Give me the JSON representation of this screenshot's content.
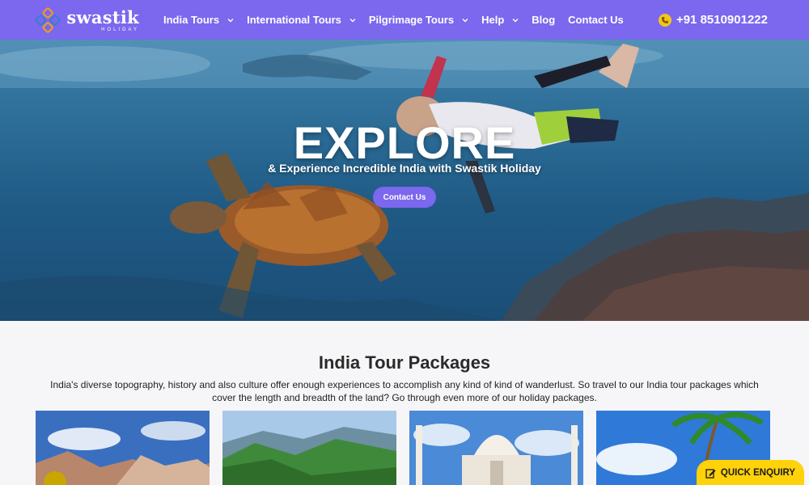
{
  "brand": {
    "name": "swastik",
    "tagline": "HOLIDAY"
  },
  "nav": {
    "items": [
      {
        "label": "India Tours",
        "dropdown": true
      },
      {
        "label": "International Tours",
        "dropdown": true
      },
      {
        "label": "Pilgrimage Tours",
        "dropdown": true
      },
      {
        "label": "Help",
        "dropdown": true
      },
      {
        "label": "Blog",
        "dropdown": false
      },
      {
        "label": "Contact Us",
        "dropdown": false
      }
    ],
    "phone": "+91 8510901222"
  },
  "hero": {
    "title": "EXPLORE",
    "subtitle": "& Experience Incredible India with Swastik Holiday",
    "button_label": "Contact Us"
  },
  "section": {
    "title": "India Tour Packages",
    "description": "India's diverse topography, history and also culture offer enough experiences to accomplish any kind of kind of wanderlust. So travel to our India tour packages which cover the length and breadth of the land? Go through even more of our holiday packages."
  },
  "cards": [
    {
      "icon": "mountain-landscape-image"
    },
    {
      "icon": "green-valley-image"
    },
    {
      "icon": "taj-mahal-image"
    },
    {
      "icon": "palm-beach-image"
    }
  ],
  "quick_enquiry": {
    "label": "QUICK ENQUIRY"
  },
  "colors": {
    "header": "#7b68ee",
    "accent": "#ffd20a",
    "phone_icon": "#f5c518"
  }
}
